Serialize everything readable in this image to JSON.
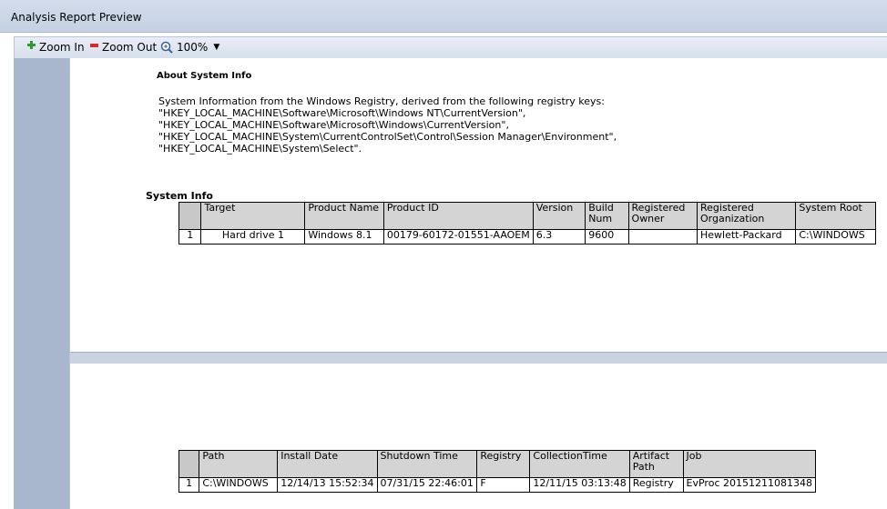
{
  "window": {
    "title": "Analysis Report Preview"
  },
  "toolbar": {
    "zoom_in_label": "Zoom In",
    "zoom_out_label": "Zoom Out",
    "zoom_level": "100%",
    "colors": {
      "zoom_in_icon": "#2e9b2e",
      "zoom_out_icon": "#d62b2b"
    }
  },
  "about": {
    "heading": "About System Info",
    "body": "System Information from the Windows Registry, derived from the following registry keys:\n\"HKEY_LOCAL_MACHINE\\Software\\Microsoft\\Windows NT\\CurrentVersion\",\n\"HKEY_LOCAL_MACHINE\\Software\\Microsoft\\Windows\\CurrentVersion\",\n\"HKEY_LOCAL_MACHINE\\System\\CurrentControlSet\\Control\\Session Manager\\Environment\",\n\"HKEY_LOCAL_MACHINE\\System\\Select\"."
  },
  "system_info": {
    "heading": "System Info",
    "table1": {
      "columns": [
        "Target",
        "Product Name",
        "Product ID",
        "Version",
        "Build Num",
        "Registered Owner",
        "Registered Organization",
        "System Root"
      ],
      "rows": [
        {
          "num": "1",
          "cells": [
            "Hard drive 1",
            "Windows 8.1",
            "00179-60172-01551-AAOEM",
            "6.3",
            "9600",
            "",
            "Hewlett-Packard",
            "C:\\WINDOWS"
          ]
        }
      ]
    },
    "table2": {
      "columns": [
        "Path",
        "Install Date",
        "Shutdown Time",
        "Registry",
        "CollectionTime",
        "Artifact Path",
        "Job"
      ],
      "rows": [
        {
          "num": "1",
          "cells": [
            "C:\\WINDOWS",
            "12/14/13 15:52:34",
            "07/31/15 22:46:01",
            "F",
            "12/11/15 03:13:48",
            "Registry",
            "EvProc 20151211081348"
          ]
        }
      ]
    }
  }
}
